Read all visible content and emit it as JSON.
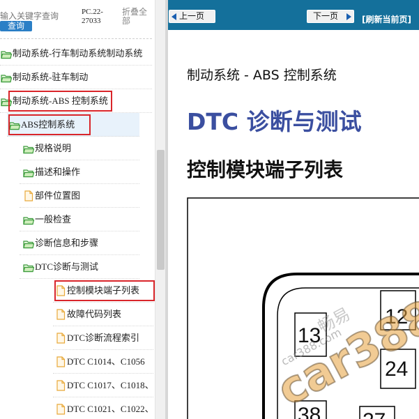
{
  "search": {
    "placeholder": "输入关键字查询",
    "button_label": "查询",
    "doc_code": "PC.22-27033",
    "collapse_all": "折叠全部"
  },
  "tree": {
    "items": [
      {
        "label": "制动系统-行车制动系统制动系统",
        "icon": "folder-open-icon"
      },
      {
        "label": "制动系统-驻车制动",
        "icon": "folder-open-icon"
      },
      {
        "label": "制动系统-ABS 控制系统",
        "icon": "folder-open-icon"
      },
      {
        "label": "ABS控制系统",
        "icon": "folder-open-icon"
      },
      {
        "label": "规格说明",
        "icon": "folder-open-icon"
      },
      {
        "label": "描述和操作",
        "icon": "folder-open-icon"
      },
      {
        "label": "部件位置图",
        "icon": "page-icon"
      },
      {
        "label": "一般检查",
        "icon": "folder-open-icon"
      },
      {
        "label": "诊断信息和步骤",
        "icon": "folder-open-icon"
      },
      {
        "label": "DTC诊断与测试",
        "icon": "folder-open-icon"
      },
      {
        "label": "控制模块端子列表",
        "icon": "page-icon"
      },
      {
        "label": "故障代码列表",
        "icon": "page-icon"
      },
      {
        "label": "DTC诊断流程索引",
        "icon": "page-icon"
      },
      {
        "label": "DTC C1014、C1056",
        "icon": "page-icon"
      },
      {
        "label": "DTC C1017、C1018、",
        "icon": "page-icon"
      },
      {
        "label": "DTC C1021、C1022、",
        "icon": "page-icon"
      }
    ]
  },
  "nav": {
    "prev_label": "上一页",
    "next_label": "下一页",
    "refresh_label": "[刷新当前页]"
  },
  "doc": {
    "section": "制动系统 - ABS 控制系统",
    "heading": "DTC 诊断与测试",
    "subheading": "控制模块端子列表",
    "pins": [
      "12",
      "13",
      "24",
      "38",
      "27"
    ]
  },
  "watermark": {
    "main": "car388",
    "sub": "car388.com",
    "cn": "畅易"
  },
  "colors": {
    "nav_bar": "#14709b",
    "heading_blue": "#3b4fa0",
    "highlight_red": "#d9252a",
    "search_button": "#2b7fc6",
    "folder_green": "#3a9a3a"
  }
}
